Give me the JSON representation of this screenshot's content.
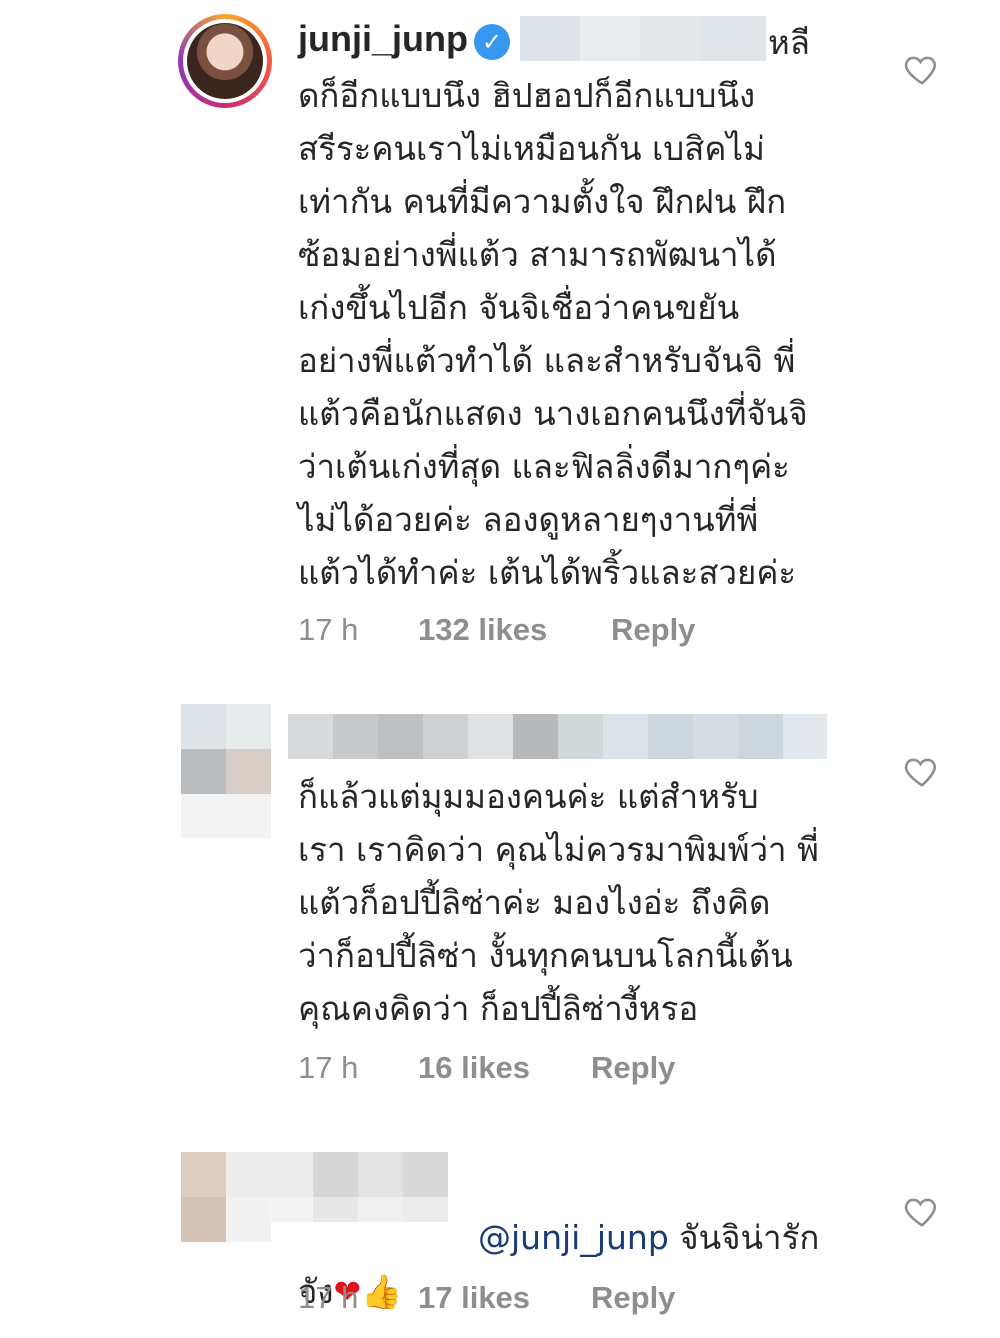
{
  "comments": [
    {
      "username": "junji_junp",
      "text_first": "หลี",
      "text": "ดก็อีกแบบนึง ฮิปฮอปก็อีกแบบนึง\nสรีระคนเราไม่เหมือนกัน เบสิคไม่\nเท่ากัน คนที่มีความตั้งใจ ฝึกฝน ฝึก\nซ้อมอย่างพี่แต้ว สามารถพัฒนาได้\nเก่งขึ้นไปอีก จันจิเชื่อว่าคนขยัน\nอย่างพี่แต้วทำได้ และสำหรับจันจิ พี่\nแต้วคือนักแสดง นางเอกคนนึงที่จันจิ\nว่าเต้นเก่งที่สุด และฟิลลิ่งดีมากๆค่ะ\nไม่ได้อวยค่ะ ลองดูหลายๆงานที่พี่\nแต้วได้ทำค่ะ เต้นได้พริ้วและสวยค่ะ",
      "time": "17 h",
      "likes": "132 likes",
      "reply": "Reply"
    },
    {
      "text": "ก็แล้วแต่มุมมองคนค่ะ แต่สำหรับ\nเรา เราคิดว่า คุณไม่ควรมาพิมพ์ว่า พี่\nแต้วก็อปปี้ลิซ่าค่ะ มองไงอ่ะ ถึงคิด\nว่าก็อปปี้ลิซ่า งั้นทุกคนบนโลกนี้เต้น\nคุณคงคิดว่า ก็อปปี้ลิซ่างี้หรอ",
      "time": "17 h",
      "likes": "16 likes",
      "reply": "Reply"
    },
    {
      "mention": "@junji_junp",
      "text_after_mention": " จันจิน่ารัก",
      "text_line2": "จัง",
      "emoji": "❤",
      "emoji2": "👍",
      "time": "17 h",
      "likes": "17 likes",
      "reply": "Reply"
    }
  ],
  "colors": {
    "text": "#262626",
    "meta": "#8e8e8e",
    "verified": "#3897f0",
    "mention": "#1a3b73"
  },
  "icons": [
    "heart-outline-icon",
    "verified-badge-icon"
  ]
}
